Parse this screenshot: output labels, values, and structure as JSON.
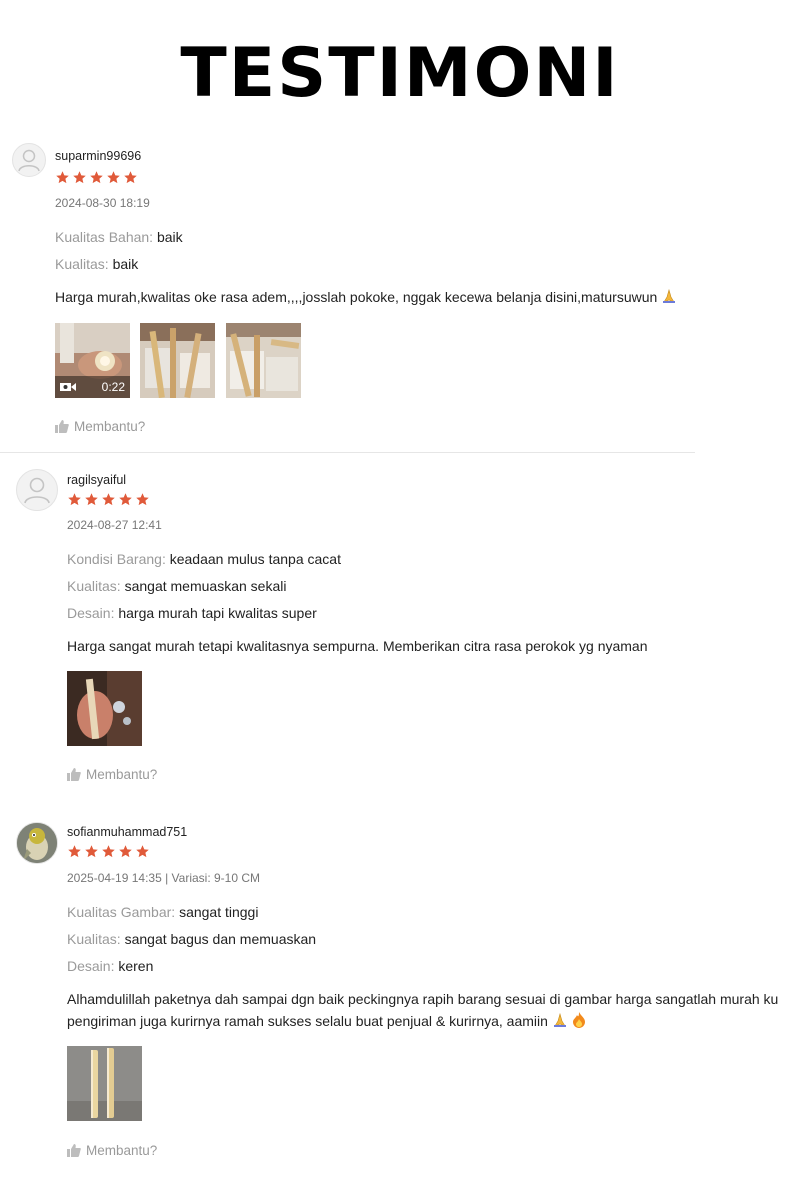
{
  "page_title": "TESTIMONI",
  "helpful_label": "Membantu?",
  "star_color": "#ee4d2d",
  "reviews": [
    {
      "username": "suparmin99696",
      "rating": 5,
      "meta": "2024-08-30 18:19",
      "attributes": [
        {
          "key": "Kualitas Bahan:",
          "value": "baik"
        },
        {
          "key": "Kualitas:",
          "value": "baik"
        }
      ],
      "comment_lines": [
        "Harga murah,kwalitas oke rasa adem,,,,josslah pokoke, nggak kecewa belanja disini,matursuwun"
      ],
      "emojis": [
        "praying-hands"
      ],
      "video_duration": "0:22"
    },
    {
      "username": "ragilsyaiful",
      "rating": 5,
      "meta": "2024-08-27 12:41",
      "attributes": [
        {
          "key": "Kondisi Barang:",
          "value": "keadaan mulus tanpa cacat"
        },
        {
          "key": "Kualitas:",
          "value": "sangat memuaskan sekali"
        },
        {
          "key": "Desain:",
          "value": "harga murah tapi kwalitas super"
        }
      ],
      "comment_lines": [
        "Harga sangat murah tetapi kwalitasnya sempurna. Memberikan citra rasa perokok yg nyaman"
      ]
    },
    {
      "username": "sofianmuhammad751",
      "rating": 5,
      "meta": "2025-04-19 14:35 | Variasi: 9-10 CM",
      "attributes": [
        {
          "key": "Kualitas Gambar:",
          "value": "sangat tinggi"
        },
        {
          "key": "Kualitas:",
          "value": "sangat bagus dan memuaskan"
        },
        {
          "key": "Desain:",
          "value": "keren"
        }
      ],
      "comment_lines": [
        "Alhamdulillah paketnya dah sampai dgn baik peckingnya rapih barang sesuai di gambar harga sangatlah murah ku",
        "pengiriman juga kurirnya ramah sukses selalu buat penjual & kurirnya, aamiin"
      ],
      "emojis": [
        "praying-hands",
        "fire"
      ]
    }
  ]
}
